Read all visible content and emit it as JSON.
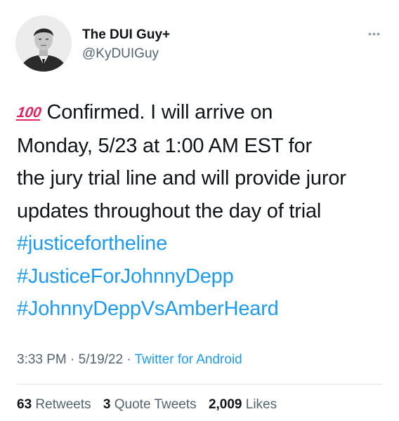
{
  "author": {
    "display_name": "The DUI Guy+",
    "handle": "@KyDUIGuy"
  },
  "more_icon": "more-dots-icon",
  "tweet": {
    "emoji": "100",
    "lines": [
      "Confirmed. I will arrive on",
      "Monday, 5/23 at 1:00 AM EST for",
      "the jury trial line and will provide juror",
      "updates throughout the day of trial"
    ],
    "hashtags": [
      "#justicefortheline",
      "#JusticeForJohnnyDepp",
      "#JohnnyDeppVsAmberHeard"
    ]
  },
  "meta": {
    "time": "3:33 PM",
    "separator": "·",
    "date": "5/19/22",
    "source": "Twitter for Android"
  },
  "stats": [
    {
      "count": "63",
      "label": "Retweets"
    },
    {
      "count": "3",
      "label": "Quote Tweets"
    },
    {
      "count": "2,009",
      "label": "Likes"
    }
  ],
  "colors": {
    "link": "#1d9bf0",
    "secondary": "#536471",
    "emoji": "#e0245e"
  }
}
